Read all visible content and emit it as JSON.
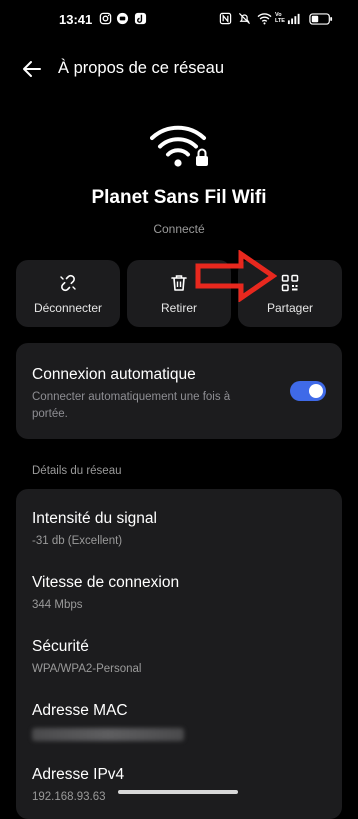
{
  "status_bar": {
    "time": "13:41",
    "left_icons": [
      "instagram-icon",
      "chat-icon",
      "tiktok-icon"
    ],
    "right_icons": [
      "nfc-icon",
      "mute-icon",
      "wifi-icon",
      "volte-icon",
      "signal-icon",
      "battery-icon"
    ],
    "volte_label": "Vo LTE"
  },
  "header": {
    "title": "À propos de ce réseau"
  },
  "network": {
    "name": "Planet Sans Fil Wifi",
    "status": "Connecté"
  },
  "actions": [
    {
      "label": "Déconnecter",
      "icon": "unlink-icon"
    },
    {
      "label": "Retirer",
      "icon": "trash-icon"
    },
    {
      "label": "Partager",
      "icon": "qr-code-icon"
    }
  ],
  "auto_connect": {
    "title": "Connexion automatique",
    "description": "Connecter automatiquement une fois à portée.",
    "enabled": true
  },
  "details": {
    "section_label": "Détails du réseau",
    "items": [
      {
        "title": "Intensité du signal",
        "value": "-31 db (Excellent)"
      },
      {
        "title": "Vitesse de connexion",
        "value": "344 Mbps"
      },
      {
        "title": "Sécurité",
        "value": "WPA/WPA2-Personal"
      },
      {
        "title": "Adresse MAC",
        "value": ""
      },
      {
        "title": "Adresse IPv4",
        "value": "192.168.93.63"
      }
    ]
  },
  "colors": {
    "accent": "#3f6ae8",
    "annotation_arrow": "#e8281e",
    "card": "#1c1c1e"
  }
}
